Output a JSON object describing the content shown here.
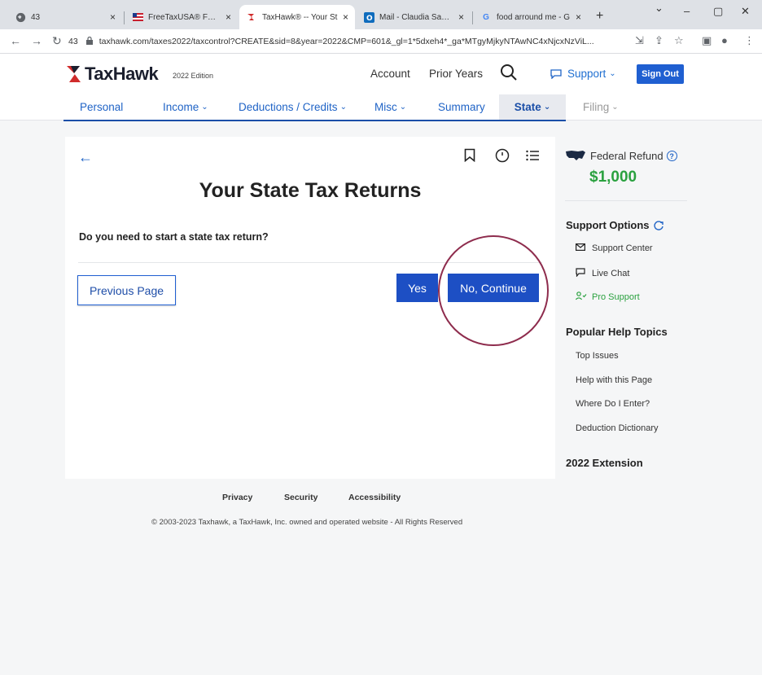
{
  "browser": {
    "tabs": [
      {
        "title": "43",
        "icon": "globe-icon",
        "close": "×"
      },
      {
        "title": "FreeTaxUSA® FREE Ta",
        "icon": "freetaxusa-flag-icon",
        "close": "×"
      },
      {
        "title": "TaxHawk® -- Your St",
        "icon": "taxhawk-icon",
        "close": "×"
      },
      {
        "title": "Mail - Claudia Sane -",
        "icon": "outlook-icon",
        "close": "×"
      },
      {
        "title": "food arround me - G",
        "icon": "google-icon",
        "close": "×"
      }
    ],
    "new_tab": "+",
    "url": "taxhawk.com/taxes2022/taxcontrol?CREATE&sid=8&year=2022&CMP=601&_gl=1*5dxeh4*_ga*MTgyMjkyNTAwNC4xNjcxNzViL...",
    "url_prefix": "43",
    "colors": {
      "tabstrip": "#dee1e6"
    }
  },
  "header": {
    "logo_text": "TaxHawk",
    "edition": "2022 Edition",
    "account": "Account",
    "prior_years": "Prior Years",
    "support": "Support",
    "sign_out": "Sign Out"
  },
  "nav": {
    "items": [
      {
        "label": "Personal"
      },
      {
        "label": "Income"
      },
      {
        "label": "Deductions / Credits"
      },
      {
        "label": "Misc"
      },
      {
        "label": "Summary"
      },
      {
        "label": "State"
      },
      {
        "label": "Filing"
      }
    ],
    "active": "State"
  },
  "main": {
    "title": "Your State Tax Returns",
    "question": "Do you need to start a state tax return?",
    "previous_page": "Previous Page",
    "yes": "Yes",
    "no_continue": "No, Continue"
  },
  "sidebar": {
    "federal_refund_label": "Federal Refund",
    "federal_refund_amount": "$1,000",
    "support_options": "Support Options",
    "support_items": [
      {
        "label": "Support Center",
        "icon": "envelope-icon"
      },
      {
        "label": "Live Chat",
        "icon": "chat-icon"
      },
      {
        "label": "Pro Support",
        "icon": "person-check-icon"
      }
    ],
    "popular_help": "Popular Help Topics",
    "help_items": [
      {
        "label": "Top Issues"
      },
      {
        "label": "Help with this Page"
      },
      {
        "label": "Where Do I Enter?"
      },
      {
        "label": "Deduction Dictionary"
      }
    ],
    "extension": "2022 Extension"
  },
  "footer": {
    "privacy": "Privacy",
    "security": "Security",
    "accessibility": "Accessibility",
    "copyright": "© 2003-2023 Taxhawk, a TaxHawk, Inc. owned and operated website - All Rights Reserved"
  },
  "colors": {
    "primary_blue": "#1d4fc4",
    "refund_green": "#2aa13f",
    "annotation_circle": "#8e2c4d"
  }
}
